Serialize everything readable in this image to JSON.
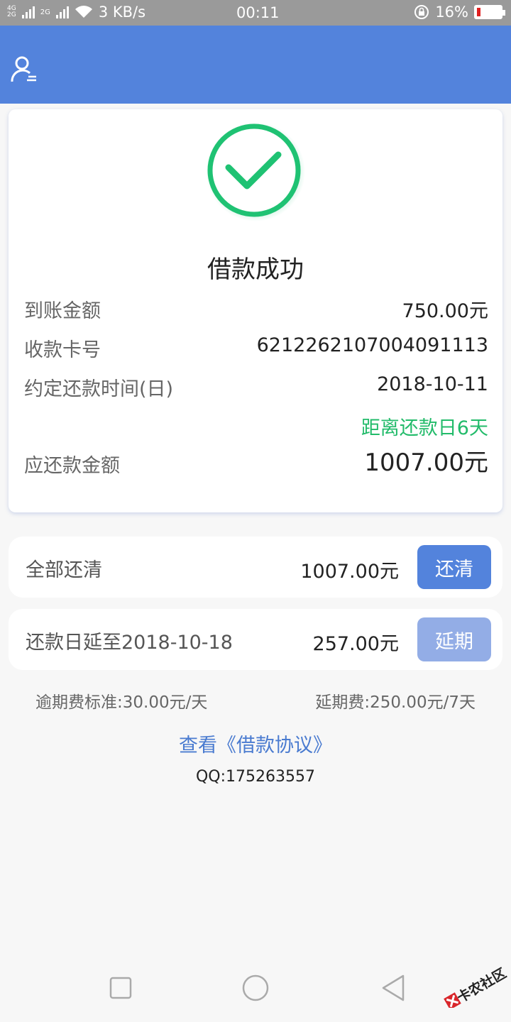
{
  "status_bar": {
    "net_top": "4G",
    "net_bottom": "2G",
    "net2": "2G",
    "speed": "3 KB/s",
    "time": "00:11",
    "battery": "16%",
    "battery_level": 0.16
  },
  "header": {
    "icon": "user-menu-icon",
    "color": "#5383dc"
  },
  "result": {
    "icon": "success-check-icon",
    "title": "借款成功",
    "rows": [
      {
        "label": "到账金额",
        "value": "750.00元"
      },
      {
        "label": "收款卡号",
        "value": "6212262107004091113"
      },
      {
        "label": "约定还款时间(日)",
        "value": "2018-10-11"
      }
    ],
    "countdown": "距离还款日6天",
    "due_label": "应还款金额",
    "due_value": "1007.00元"
  },
  "options": {
    "full": {
      "label": "全部还清",
      "amount": "1007.00元",
      "button": "还清"
    },
    "extend": {
      "label": "还款日延至2018-10-18",
      "amount": "257.00元",
      "button": "延期"
    }
  },
  "fees": {
    "overdue": "逾期费标准:30.00元/天",
    "extension": "延期费:250.00元/7天"
  },
  "agreement_link": "查看《借款协议》",
  "contact": "QQ:175263557",
  "nav": {
    "recent": "square-icon",
    "home": "circle-icon",
    "back": "triangle-back-icon"
  },
  "watermark": "卡农社区",
  "colors": {
    "primary": "#5383dc",
    "success": "#22bb6a",
    "disabled": "#93ade6"
  }
}
